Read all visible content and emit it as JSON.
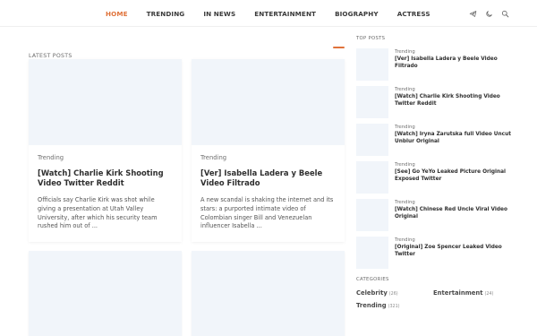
{
  "nav": {
    "items": [
      {
        "label": "HOME",
        "active": true
      },
      {
        "label": "TRENDING",
        "active": false
      },
      {
        "label": "IN NEWS",
        "active": false
      },
      {
        "label": "ENTERTAINMENT",
        "active": false
      },
      {
        "label": "BIOGRAPHY",
        "active": false
      },
      {
        "label": "ACTRESS",
        "active": false
      }
    ],
    "icons": [
      "telegram-icon",
      "dark-mode-moon-icon",
      "search-icon"
    ],
    "accent_color": "#e0733b"
  },
  "latest": {
    "title": "LATEST POSTS",
    "posts": [
      {
        "label": "Trending",
        "title": "[Watch] Charlie Kirk Shooting Video Twitter Reddit",
        "excerpt": "Officials say Charlie Kirk was shot while giving a presentation at Utah Valley University, after which his security team rushed him out of ..."
      },
      {
        "label": "Trending",
        "title": "[Ver] Isabella Ladera y Beele Video Filtrado",
        "excerpt": "A new scandal is shaking the internet and its stars: a purported intimate video of Colombian singer Bill and Venezuelan influencer Isabella ..."
      }
    ]
  },
  "sidebar": {
    "top_posts_title": "TOP POSTS",
    "top_posts": [
      {
        "label": "Trending",
        "title": "[Ver] Isabella Ladera y Beele Video Filtrado"
      },
      {
        "label": "Trending",
        "title": "[Watch] Charlie Kirk Shooting Video Twitter Reddit"
      },
      {
        "label": "Trending",
        "title": "[Watch] Iryna Zarutska full Video Uncut Unblur Original"
      },
      {
        "label": "Trending",
        "title": "[See] Go YeYo Leaked Picture Original Exposed Twitter"
      },
      {
        "label": "Trending",
        "title": "[Watch] Chinese Red Uncle Viral Video Original"
      },
      {
        "label": "Trending",
        "title": "[Original] Zoe Spencer Leaked Video Twitter"
      }
    ],
    "categories_title": "CATEGORIES",
    "categories": [
      {
        "name": "Celebrity",
        "count": "(26)"
      },
      {
        "name": "Entertainment",
        "count": "(24)"
      },
      {
        "name": "Trending",
        "count": "(321)"
      }
    ]
  }
}
